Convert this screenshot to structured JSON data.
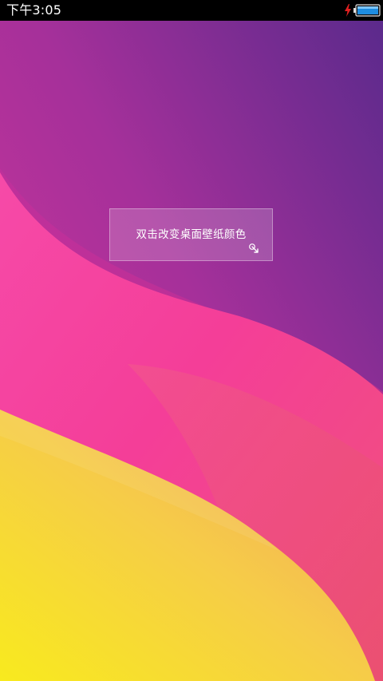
{
  "status_bar": {
    "time": "下午3:05",
    "charging_icon": "lightning-bolt",
    "battery_icon": "battery-charging"
  },
  "wallpaper": {
    "colors": {
      "top_right": "#5a2a8c",
      "magenta": "#c8288e",
      "pink": "#f43e9a",
      "coral": "#f25a7a",
      "yellow": "#f8e81e",
      "orange": "#f2b45a"
    }
  },
  "hint": {
    "text": "双击改变桌面壁纸颜色",
    "icon": "double-tap-icon"
  }
}
